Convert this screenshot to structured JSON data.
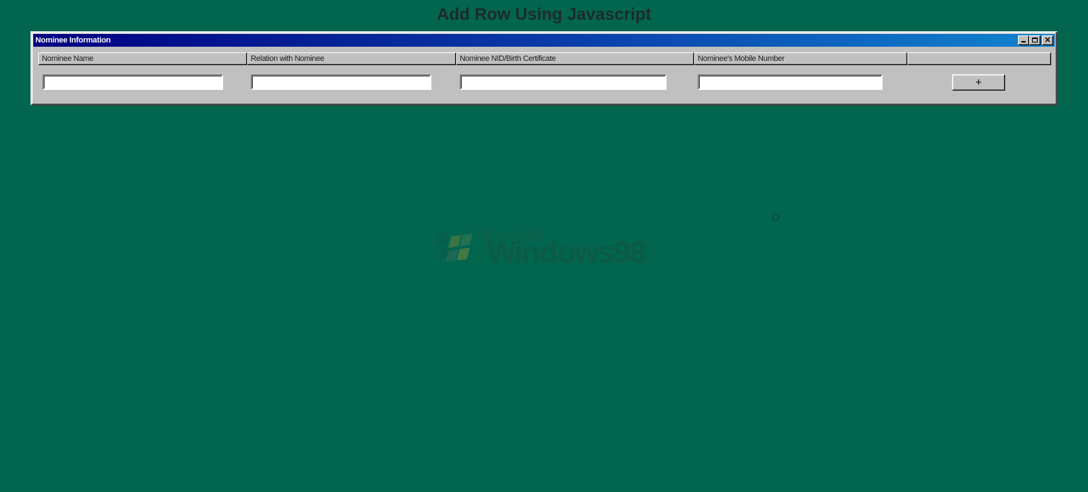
{
  "page": {
    "title": "Add Row Using Javascript",
    "background_color": "#02664f"
  },
  "window": {
    "title": "Nominee Information",
    "controls": {
      "minimize": "minimize-icon",
      "maximize": "maximize-icon",
      "close": "close-icon"
    },
    "columns": [
      "Nominee Name",
      "Relation with Nominee",
      "Nominee NID/Birth Certificate",
      "Nominee's Mobile Number",
      ""
    ],
    "row": {
      "name_value": "",
      "relation_value": "",
      "nid_value": "",
      "mobile_value": "",
      "add_label": "+"
    }
  },
  "watermark": {
    "brand_small": "Microsoft",
    "brand_large": "Windows98"
  }
}
